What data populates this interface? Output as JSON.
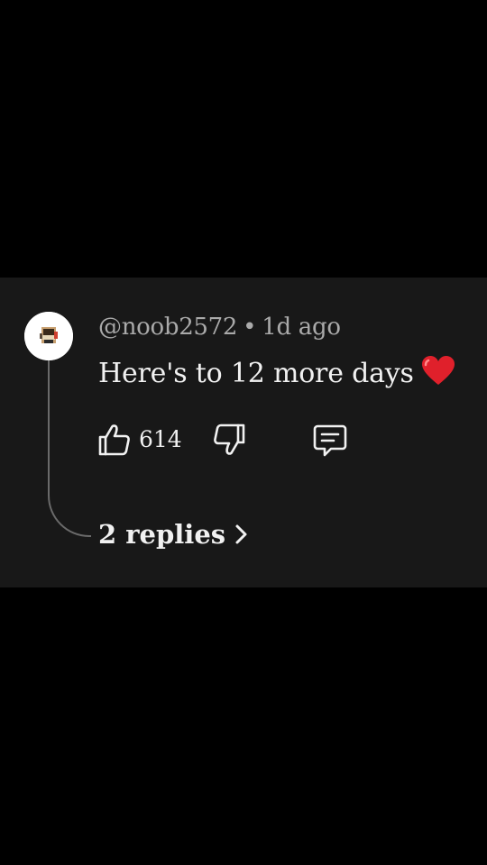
{
  "colors": {
    "background": "#000000",
    "card": "#181818",
    "text_primary": "#f1f1f1",
    "text_secondary": "#aaaaaa",
    "thread_line": "#6a6a6a",
    "heart": "#e0202b"
  },
  "comment": {
    "username": "@noob2572",
    "separator": "•",
    "timestamp": "1d ago",
    "text": "Here's to 12 more days",
    "emoji_icon": "red-heart-icon",
    "like_icon": "thumbs-up-icon",
    "like_count": "614",
    "dislike_icon": "thumbs-down-icon",
    "reply_icon": "comment-icon",
    "replies_label": "2 replies",
    "replies_icon": "chevron-right-icon"
  }
}
